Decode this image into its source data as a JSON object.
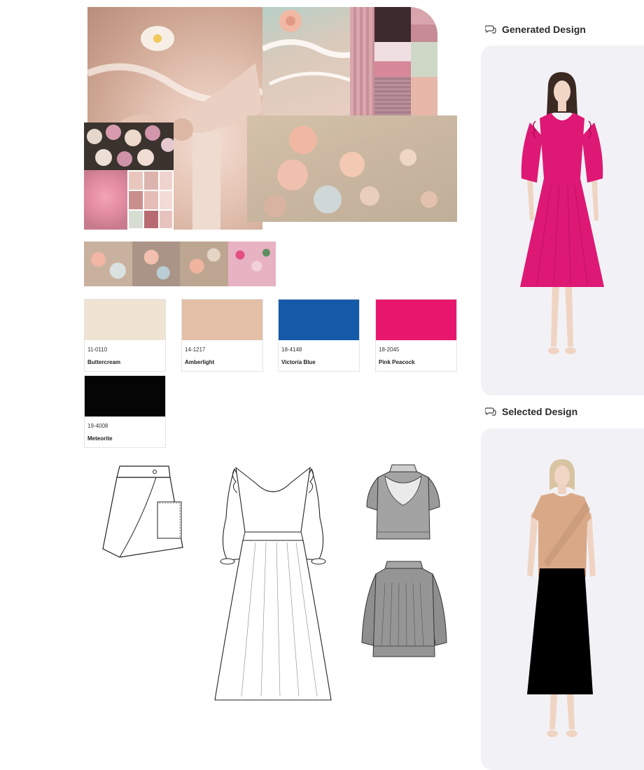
{
  "palette": [
    {
      "code": "11-0110",
      "name": "Buttercream",
      "hex": "#efe3d3"
    },
    {
      "code": "14-1217",
      "name": "Amberlight",
      "hex": "#e2bfa6"
    },
    {
      "code": "18-4148",
      "name": "Victoria Blue",
      "hex": "#145aa8"
    },
    {
      "code": "18-2045",
      "name": "Pink Peacock",
      "hex": "#e8176e"
    },
    {
      "code": "19-4008",
      "name": "Meteorite",
      "hex": "#050505"
    }
  ],
  "panels": {
    "generated": {
      "title": "Generated Design",
      "icon": "chat-bubbles-icon"
    },
    "selected": {
      "title": "Selected Design",
      "icon": "chat-bubbles-icon"
    }
  },
  "colors": {
    "panel_bg": "#f2f2f6",
    "generated_dress": "#de1875",
    "selected_top": "#d9a987",
    "selected_skirt": "#000000"
  }
}
